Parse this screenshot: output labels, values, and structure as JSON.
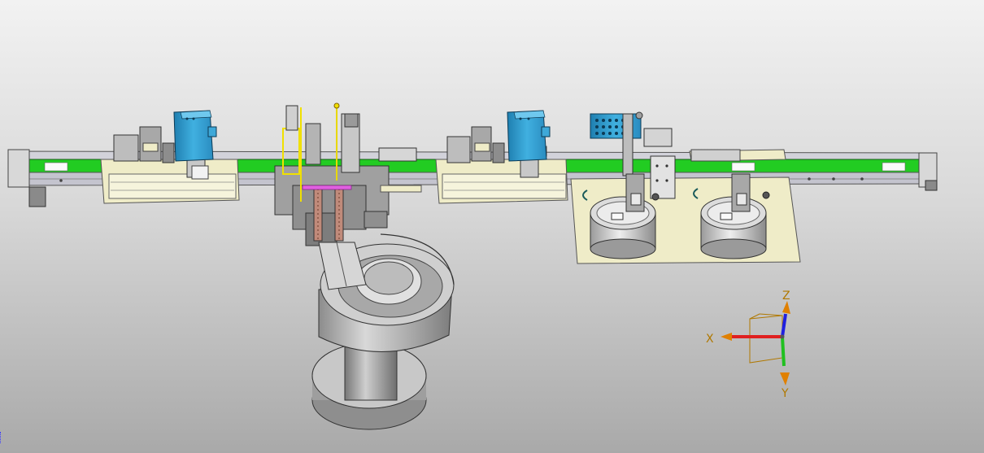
{
  "viewport": {
    "background_top": "#f2f2f2",
    "background_bottom": "#a9a9a9"
  },
  "triad": {
    "x_label": "X",
    "y_label": "Y",
    "z_label": "Z",
    "x_color": "#e02020",
    "y_color": "#20c020",
    "z_color": "#2020e0",
    "label_color": "#b07800"
  },
  "colors": {
    "belt": "#22cc22",
    "rail": "#c8c8d2",
    "base_plate": "#efecc8",
    "controller_box": "#2f9bd0",
    "steel": "#9a9a9a",
    "highlight_yellow": "#f0e000",
    "highlight_magenta": "#e060e0"
  }
}
